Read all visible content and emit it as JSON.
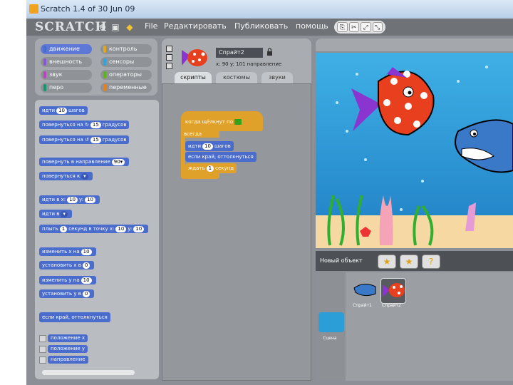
{
  "window": {
    "title": "Scratch 1.4 of 30 Jun 09"
  },
  "menubar": {
    "logo": "SCRATCH",
    "items": [
      "File",
      "Редактировать",
      "Публиковать",
      "помощь"
    ]
  },
  "categories": [
    {
      "label": "движение",
      "color": "#4a6ccd",
      "selected": true
    },
    {
      "label": "контроль",
      "color": "#e1a91a",
      "selected": false
    },
    {
      "label": "внешность",
      "color": "#8a55d7",
      "selected": false
    },
    {
      "label": "сенсоры",
      "color": "#2ca5e2",
      "selected": false
    },
    {
      "label": "звук",
      "color": "#bb42c3",
      "selected": false
    },
    {
      "label": "операторы",
      "color": "#5cb712",
      "selected": false
    },
    {
      "label": "перо",
      "color": "#0e9a6c",
      "selected": false
    },
    {
      "label": "переменные",
      "color": "#ee7d16",
      "selected": false
    }
  ],
  "palette": {
    "move": {
      "pre": "идти",
      "val": "10",
      "post": "шагов"
    },
    "turn_right": {
      "pre": "повернуться на ↻",
      "val": "15",
      "post": "градусов"
    },
    "turn_left": {
      "pre": "повернуться на ↺",
      "val": "15",
      "post": "градусов"
    },
    "point_dir": {
      "pre": "повернуть в направление",
      "val": "90▾"
    },
    "point_to": {
      "pre": "повернуться к"
    },
    "goto_xy": {
      "pre": "идти в x:",
      "x": "10",
      "mid": "y:",
      "y": "10"
    },
    "goto": {
      "pre": "идти в"
    },
    "glide": {
      "pre": "плыть",
      "val": "1",
      "mid": "секунд в точку x:",
      "x": "10",
      "mid2": "y:",
      "y": "10"
    },
    "change_x": {
      "pre": "изменить x на",
      "val": "10"
    },
    "set_x": {
      "pre": "установить x в",
      "val": "0"
    },
    "change_y": {
      "pre": "изменить y на",
      "val": "10"
    },
    "set_y": {
      "pre": "установить y в",
      "val": "0"
    },
    "bounce": {
      "label": "если край, оттолкнуться"
    },
    "reporters": [
      "положение x",
      "положение y",
      "направление"
    ]
  },
  "sprite": {
    "name": "Спрайт2",
    "coords": "x: 90  y: 101  направление"
  },
  "tabs": [
    "скрипты",
    "костюмы",
    "звуки"
  ],
  "script": {
    "hat": "когда щёлкнут по",
    "forever": "всегда",
    "move": {
      "pre": "идти",
      "val": "10",
      "post": "шагов"
    },
    "bounce": "если край, оттолкнуться",
    "wait": {
      "pre": "ждать",
      "val": "1",
      "post": "секунд"
    }
  },
  "sprites_pane": {
    "new_label": "Новый объект",
    "stage_label": "Сцена",
    "sprites": [
      {
        "label": "Спрайт1",
        "selected": false
      },
      {
        "label": "Спрайт2",
        "selected": true
      }
    ]
  }
}
